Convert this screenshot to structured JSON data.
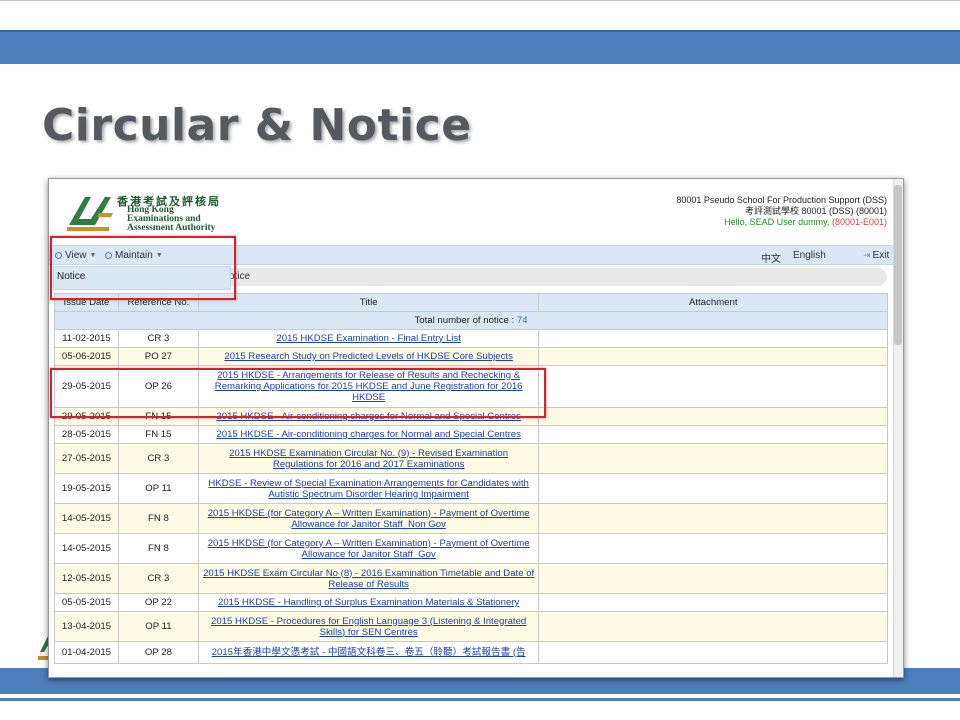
{
  "slide": {
    "title": "Circular & Notice"
  },
  "app": {
    "logo_cn": "香港考試及評核局",
    "logo_en": [
      "Hong Kong",
      "Examinations and",
      "Assessment Authority"
    ],
    "school_en": "80001 Pseudo School For Production Support (DSS)",
    "school_cn": "考評測試學校 80001 (DSS) (80001)",
    "hello_prefix": "Hello, SEAD User dummy, ",
    "hello_code": "(80001-E001)"
  },
  "menu": {
    "view": "View",
    "maintain": "Maintain",
    "lang_cn": "中文",
    "lang_en": "English",
    "exit": "Exit"
  },
  "dropdown": {
    "item": "Notice"
  },
  "breadcrumb": "otice",
  "table": {
    "total_label": "Total number of notice : ",
    "total_value": "74",
    "headers": [
      "Issue Date",
      "Reference No.",
      "Title",
      "Attachment"
    ],
    "rows": [
      {
        "date": "11-02-2015",
        "ref": "CR 3",
        "title": "2015 HKDSE Examination - Final Entry List"
      },
      {
        "date": "05-06-2015",
        "ref": "PO 27",
        "title": "2015 Research Study on Predicted Levels of HKDSE Core Subjects"
      },
      {
        "date": "29-05-2015",
        "ref": "OP 26",
        "title": "2015 HKDSE - Arrangements for Release of Results and Rechecking & Remarking Applications for 2015 HKDSE and June Registration for 2016 HKDSE"
      },
      {
        "date": "29-05-2015",
        "ref": "FN 15",
        "title": "2015 HKDSE - Air-conditioning charges for Normal and Special Centres"
      },
      {
        "date": "28-05-2015",
        "ref": "FN 15",
        "title": "2015 HKDSE - Air-conditioning charges for Normal and Special Centres"
      },
      {
        "date": "27-05-2015",
        "ref": "CR 3",
        "title": "2015 HKDSE Examination Circular No. (9) - Revised Examination Regulations for 2016 and 2017 Examinations"
      },
      {
        "date": "19-05-2015",
        "ref": "OP 11",
        "title": "HKDSE - Review of Special Examination Arrangements for Candidates with Autistic Spectrum Disorder Hearing Impairment"
      },
      {
        "date": "14-05-2015",
        "ref": "FN 8",
        "title": "2015 HKDSE (for Category A – Written Examination) - Payment of Overtime Allowance for Janitor Staff_Non Gov"
      },
      {
        "date": "14-05-2015",
        "ref": "FN 8",
        "title": "2015 HKDSE (for Category A – Written Examination) - Payment of Overtime Allowance for Janitor Staff_Gov"
      },
      {
        "date": "12-05-2015",
        "ref": "CR 3",
        "title": "2015 HKDSE Exam Circular No (8) - 2016 Examination Timetable and Date of Release of Results"
      },
      {
        "date": "05-05-2015",
        "ref": "OP 22",
        "title": "2015 HKDSE - Handling of Surplus Examination Materials & Stationery"
      },
      {
        "date": "13-04-2015",
        "ref": "OP 11",
        "title": "2015 HKDSE - Procedures for English Language 3 (Listening & Integrated Skills) for SEN Centres"
      },
      {
        "date": "01-04-2015",
        "ref": "OP 28",
        "title": "2015年香港中學文憑考試 - 中國語文科卷三、卷五（聆聽）考試報告書 (告"
      }
    ]
  }
}
